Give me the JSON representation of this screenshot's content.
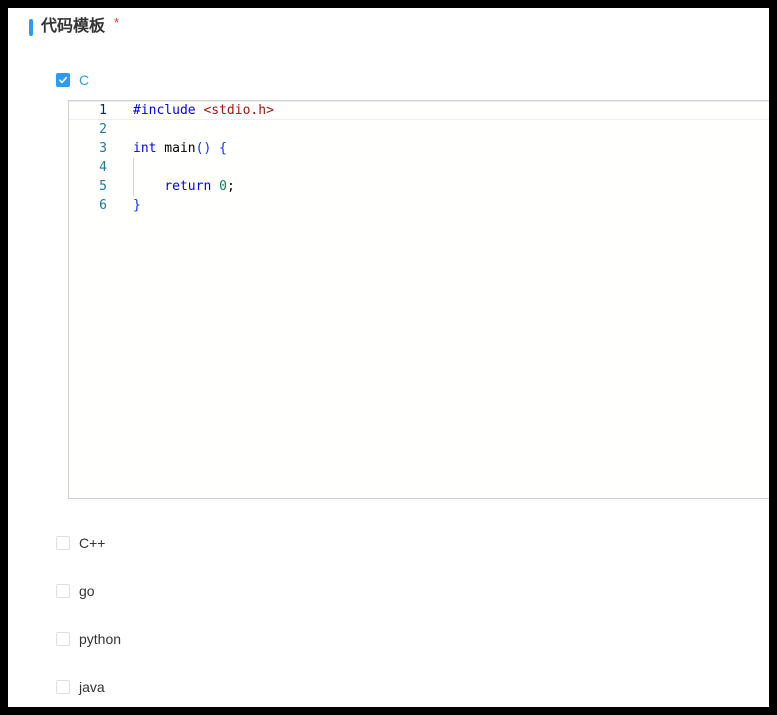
{
  "section": {
    "title": "代码模板",
    "required_mark": "*"
  },
  "languages": [
    {
      "label": "C",
      "checked": true
    },
    {
      "label": "C++",
      "checked": false
    },
    {
      "label": "go",
      "checked": false
    },
    {
      "label": "python",
      "checked": false
    },
    {
      "label": "java",
      "checked": false
    }
  ],
  "editor": {
    "line_numbers": [
      "1",
      "2",
      "3",
      "4",
      "5",
      "6"
    ],
    "code": {
      "line1_directive": "#include",
      "line1_header": "<stdio.h>",
      "line3_keyword": "int",
      "line3_name": " main",
      "line3_parens": "()",
      "line3_brace": " {",
      "line5_keyword": "return",
      "line5_number": "0",
      "line5_semicolon": ";",
      "line6_brace": "}"
    }
  },
  "colors": {
    "accent": "#2d9cf0",
    "required": "#e8392d",
    "keyword": "#0000ff",
    "string": "#a31515",
    "number": "#098658",
    "line_number": "#237893"
  }
}
